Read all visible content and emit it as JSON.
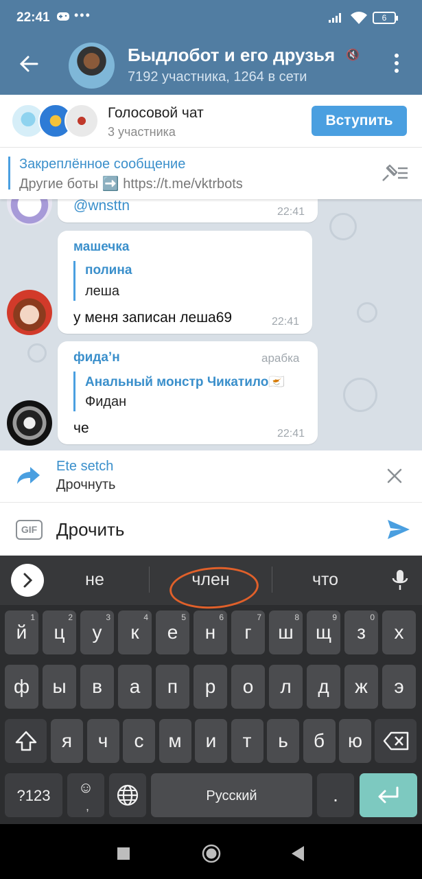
{
  "status": {
    "time": "22:41",
    "battery": "6"
  },
  "header": {
    "title": "Быдлобот и его друзья",
    "subtitle": "7192 участника, 1264 в сети"
  },
  "voice_chat": {
    "title": "Голосовой чат",
    "subtitle": "3 участника",
    "join_label": "Вступить"
  },
  "pinned": {
    "title": "Закреплённое сообщение",
    "text": "Другие боты ➡️ https://t.me/vktrbots"
  },
  "messages": [
    {
      "text": "@wnsttn",
      "time": "22:41"
    },
    {
      "sender": "машечка",
      "reply_name": "полина",
      "reply_text": "леша",
      "text": "у меня записан леша69",
      "time": "22:41"
    },
    {
      "sender": "фида’н",
      "admin_title": "арабка",
      "reply_name": "Анальный монстр Чикатило🇨🇾",
      "reply_text": "Фидан",
      "text": "че",
      "time": "22:41"
    }
  ],
  "forward": {
    "name": "Ete setch",
    "text": "Дрочнуть"
  },
  "input": {
    "gif_label": "GIF",
    "text": "Дрочить"
  },
  "keyboard": {
    "suggestions": [
      "не",
      "член",
      "что"
    ],
    "row1": [
      {
        "k": "й",
        "h": "1"
      },
      {
        "k": "ц",
        "h": "2"
      },
      {
        "k": "у",
        "h": "3"
      },
      {
        "k": "к",
        "h": "4"
      },
      {
        "k": "е",
        "h": "5"
      },
      {
        "k": "н",
        "h": "6"
      },
      {
        "k": "г",
        "h": "7"
      },
      {
        "k": "ш",
        "h": "8"
      },
      {
        "k": "щ",
        "h": "9"
      },
      {
        "k": "з",
        "h": "0"
      },
      {
        "k": "х",
        "h": ""
      }
    ],
    "row2": [
      "ф",
      "ы",
      "в",
      "а",
      "п",
      "р",
      "о",
      "л",
      "д",
      "ж",
      "э"
    ],
    "row3": [
      "я",
      "ч",
      "с",
      "м",
      "и",
      "т",
      "ь",
      "б",
      "ю"
    ],
    "symbols_label": "?123",
    "space_label": "Русский",
    "period_label": "."
  }
}
